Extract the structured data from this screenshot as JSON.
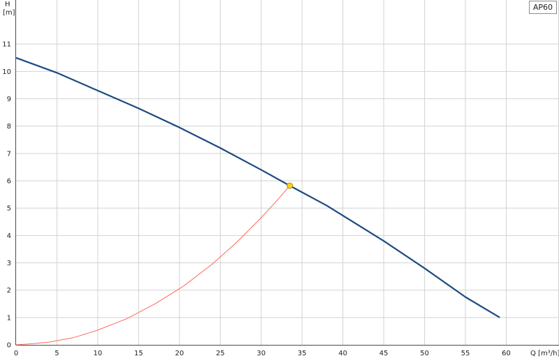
{
  "chart_data": {
    "type": "line",
    "xlabel": "Q [m³/h]",
    "ylabel_top": "H",
    "ylabel_unit": "[m]",
    "xlim": [
      0,
      65
    ],
    "ylim": [
      0,
      12
    ],
    "x_ticks": [
      0,
      5,
      10,
      15,
      20,
      25,
      30,
      35,
      40,
      45,
      50,
      55,
      60
    ],
    "y_ticks": [
      0,
      1,
      2,
      3,
      4,
      5,
      6,
      7,
      8,
      9,
      10,
      11
    ],
    "grid": true,
    "legend": {
      "text": "AP60",
      "placement": "top-right"
    },
    "series": [
      {
        "name": "AP60",
        "color": "#1c4a80",
        "x": [
          0,
          5,
          10,
          15,
          20,
          25,
          30,
          33.5,
          38,
          45,
          50,
          55,
          59.2
        ],
        "y": [
          10.5,
          9.95,
          9.3,
          8.65,
          7.95,
          7.2,
          6.4,
          5.82,
          5.1,
          3.8,
          2.8,
          1.75,
          1.0
        ]
      },
      {
        "name": "",
        "color": "#ff6a5a",
        "x": [
          0,
          2,
          4,
          7,
          10,
          13.5,
          17,
          20.5,
          24,
          27,
          30,
          32,
          33.5
        ],
        "y": [
          0,
          0.04,
          0.1,
          0.26,
          0.54,
          0.95,
          1.5,
          2.15,
          2.95,
          3.75,
          4.65,
          5.3,
          5.82
        ]
      }
    ],
    "operating_point": {
      "x": 33.5,
      "y": 5.82,
      "color": "#ffd21a"
    }
  }
}
